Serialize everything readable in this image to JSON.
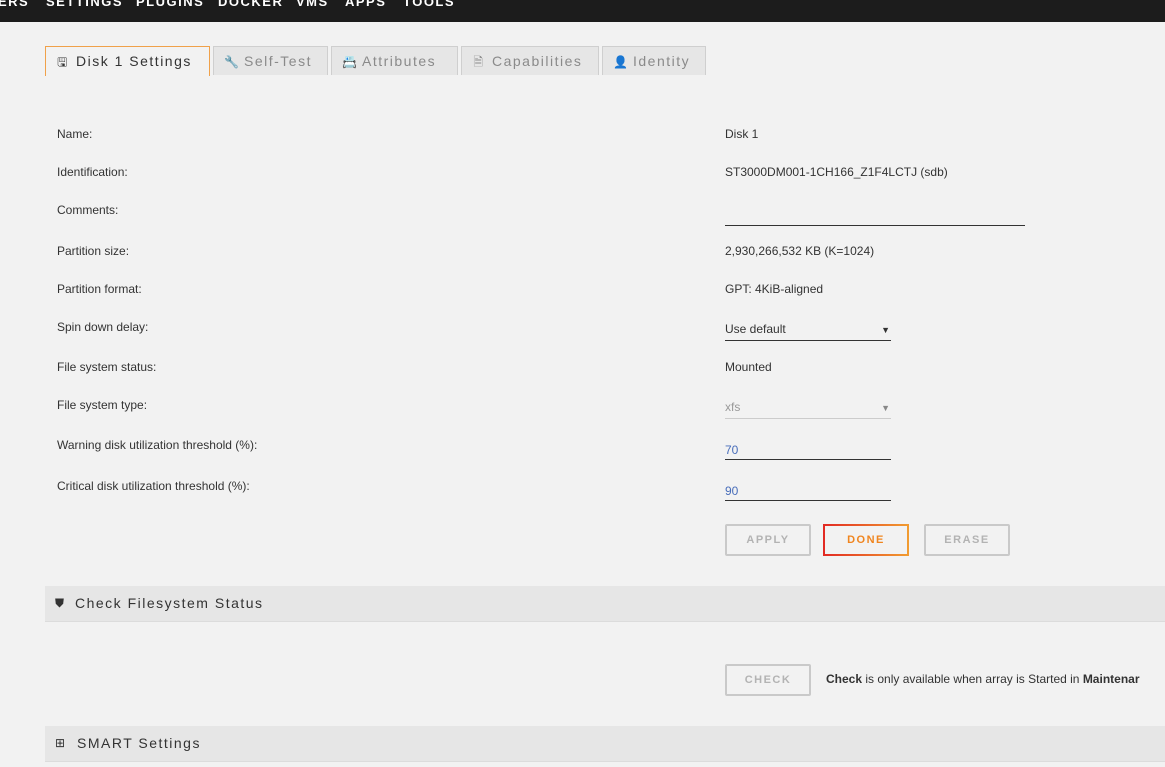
{
  "nav": {
    "items": [
      "ERS",
      "SETTINGS",
      "PLUGINS",
      "DOCKER",
      "VMS",
      "APPS",
      "TOOLS"
    ]
  },
  "tabs": [
    {
      "label": "Disk 1 Settings",
      "icon": "hdd-icon",
      "active": true
    },
    {
      "label": "Self-Test",
      "icon": "wrench-icon",
      "active": false
    },
    {
      "label": "Attributes",
      "icon": "id-card-icon",
      "active": false
    },
    {
      "label": "Capabilities",
      "icon": "document-icon",
      "active": false
    },
    {
      "label": "Identity",
      "icon": "user-icon",
      "active": false
    }
  ],
  "form": {
    "name_label": "Name:",
    "name_value": "Disk 1",
    "identification_label": "Identification:",
    "identification_value": "ST3000DM001-1CH166_Z1F4LCTJ (sdb)",
    "comments_label": "Comments:",
    "comments_value": "",
    "partition_size_label": "Partition size:",
    "partition_size_value": "2,930,266,532 KB (K=1024)",
    "partition_format_label": "Partition format:",
    "partition_format_value": "GPT: 4KiB-aligned",
    "spin_down_label": "Spin down delay:",
    "spin_down_value": "Use default",
    "fs_status_label": "File system status:",
    "fs_status_value": "Mounted",
    "fs_type_label": "File system type:",
    "fs_type_value": "xfs",
    "warning_label": "Warning disk utilization threshold (%):",
    "warning_value": "70",
    "critical_label": "Critical disk utilization threshold (%):",
    "critical_value": "90"
  },
  "buttons": {
    "apply": "APPLY",
    "done": "DONE",
    "erase": "ERASE",
    "check": "CHECK"
  },
  "sections": {
    "check_fs_title": "Check Filesystem Status",
    "smart_title": "SMART Settings"
  },
  "check_message": {
    "bold1": "Check",
    "text": " is only available when array is Started in ",
    "bold2": "Maintenar"
  },
  "colors": {
    "accent_orange": "#f0851f",
    "nav_bg": "#1c1c1c",
    "input_value": "#486dba"
  }
}
